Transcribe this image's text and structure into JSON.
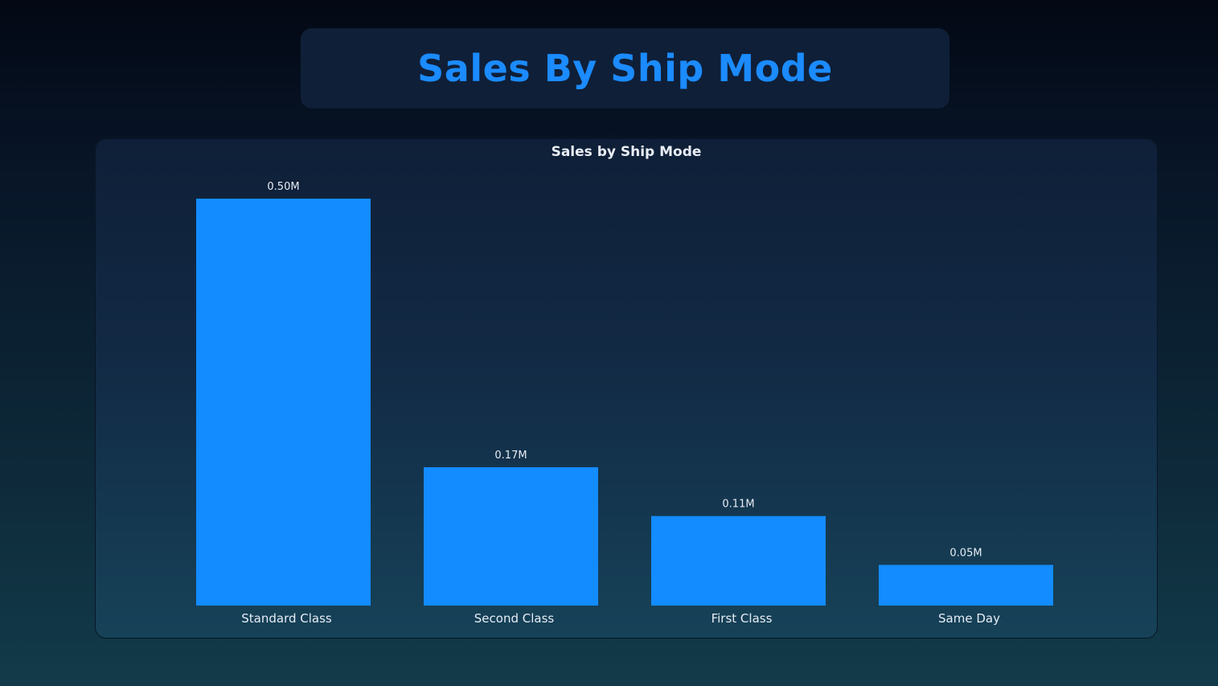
{
  "page": {
    "title": "Sales By Ship Mode"
  },
  "chart_data": {
    "type": "bar",
    "title": "Sales by Ship Mode",
    "categories": [
      "Standard Class",
      "Second Class",
      "First Class",
      "Same Day"
    ],
    "values": [
      500000,
      170000,
      110000,
      50000
    ],
    "data_labels": [
      "0.50M",
      "0.17M",
      "0.11M",
      "0.05M"
    ],
    "ylim": [
      0,
      500000
    ],
    "grid": false,
    "legend": "none",
    "xlabel": "",
    "ylabel": "",
    "colors": {
      "bar": "#138cff",
      "title_text": "#1b8bff"
    }
  }
}
